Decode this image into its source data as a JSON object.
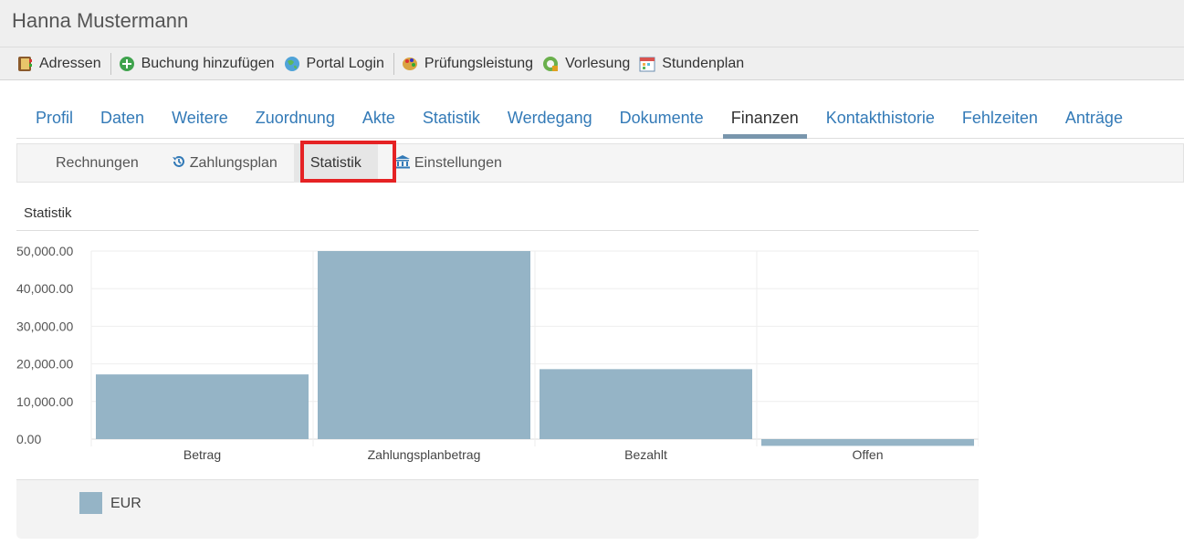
{
  "header": {
    "title": "Hanna Mustermann"
  },
  "toolbar": {
    "items": [
      {
        "label": "Adressen",
        "icon": "address-book-icon"
      },
      {
        "label": "Buchung hinzufügen",
        "icon": "plus-circle-icon"
      },
      {
        "label": "Portal Login",
        "icon": "globe-icon"
      },
      {
        "label": "Prüfungsleistung",
        "icon": "palette-icon"
      },
      {
        "label": "Vorlesung",
        "icon": "lecture-icon"
      },
      {
        "label": "Stundenplan",
        "icon": "calendar-icon"
      }
    ]
  },
  "tabs": [
    "Profil",
    "Daten",
    "Weitere",
    "Zuordnung",
    "Akte",
    "Statistik",
    "Werdegang",
    "Dokumente",
    "Finanzen",
    "Kontakthistorie",
    "Fehlzeiten",
    "Anträge"
  ],
  "active_tab": "Finanzen",
  "subtabs": [
    {
      "label": "Rechnungen",
      "icon": ""
    },
    {
      "label": "Zahlungsplan",
      "icon": "history-icon"
    },
    {
      "label": "Statistik",
      "icon": ""
    },
    {
      "label": "Einstellungen",
      "icon": "bank-icon"
    }
  ],
  "active_subtab": "Statistik",
  "panel": {
    "title": "Statistik"
  },
  "chart_data": {
    "type": "bar",
    "categories": [
      "Betrag",
      "Zahlungsplanbetrag",
      "Bezahlt",
      "Offen"
    ],
    "series": [
      {
        "name": "EUR",
        "values": [
          17200,
          50000,
          18600,
          -1800
        ]
      }
    ],
    "y_ticks": [
      "0.00",
      "10,000.00",
      "20,000.00",
      "30,000.00",
      "40,000.00",
      "50,000.00"
    ],
    "ylim": [
      -1800,
      50000
    ],
    "bar_color": "#95b4c6",
    "grid": true,
    "legend": "bottom-left"
  },
  "colors": {
    "accent": "#337ab7",
    "highlight": "#e52224",
    "bar": "#95b4c6"
  }
}
